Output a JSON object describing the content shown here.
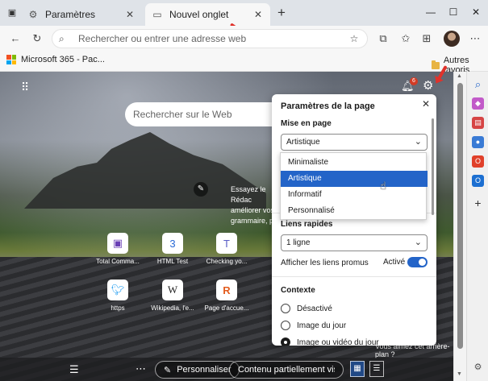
{
  "browser": {
    "tabs": [
      {
        "label": "Paramètres",
        "icon": "gear-icon",
        "active": false
      },
      {
        "label": "Nouvel onglet",
        "icon": "page-icon",
        "active": true
      }
    ],
    "address_placeholder": "Rechercher ou entrer une adresse web",
    "favorites": {
      "item": "Microsoft 365 - Pac...",
      "folder": "Autres favoris"
    }
  },
  "newtab": {
    "search_placeholder": "Rechercher sur le Web",
    "notification_count": "6",
    "promo_prefix": "Essayez le Rédac",
    "promo_text": "améliorer vos éc grammaire, ponc",
    "quick_links": [
      {
        "label": "Total Comma...",
        "icon": "save-icon",
        "color": "#6a3fb5"
      },
      {
        "label": "HTML Test",
        "icon": "css-icon",
        "color": "#2a6ad6"
      },
      {
        "label": "Checking yo...",
        "icon": "teams-icon",
        "color": "#5b5fc7"
      },
      {
        "label": "https",
        "icon": "twitter-icon",
        "color": "#1d9bf0"
      },
      {
        "label": "Wikipedia, l'e...",
        "icon": "wikipedia-icon",
        "color": "#222222"
      },
      {
        "label": "Page d'accue...",
        "icon": "r-icon",
        "color": "#e35d1f"
      }
    ],
    "bottom_bar": {
      "personalize": "Personnaliser",
      "content": "Contenu partiellement visi...",
      "background_question": "Vous aimez cet arrière-plan ?"
    }
  },
  "settings_panel": {
    "title": "Paramètres de la page",
    "layout_section": "Mise en page",
    "layout_value": "Artistique",
    "layout_options": [
      "Minimaliste",
      "Artistique",
      "Informatif",
      "Personnalisé"
    ],
    "quick_links_section": "Liens rapides",
    "quick_links_value": "1 ligne",
    "promo_links_label": "Afficher les liens promus",
    "promo_links_state": "Activé",
    "context_section": "Contexte",
    "context_options": [
      "Désactivé",
      "Image du jour",
      "Image ou vidéo du jour"
    ]
  },
  "colors": {
    "accent": "#2364c8",
    "badge": "#d23b25"
  }
}
